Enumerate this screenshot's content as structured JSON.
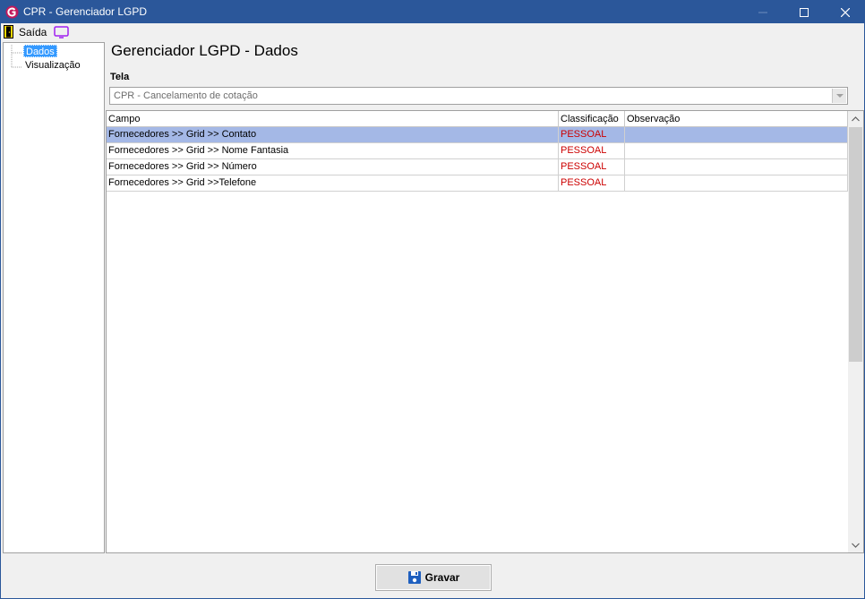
{
  "window": {
    "title": "CPR - Gerenciador LGPD"
  },
  "menu": {
    "exit_label": "Saída",
    "exit_icon": "door-exit-icon",
    "screen_icon": "monitor-icon"
  },
  "tree": {
    "items": [
      {
        "label": "Dados",
        "selected": true
      },
      {
        "label": "Visualização",
        "selected": false
      }
    ]
  },
  "main": {
    "title": "Gerenciador LGPD - Dados",
    "tela_label": "Tela",
    "tela_value": "CPR - Cancelamento de cotação"
  },
  "grid": {
    "columns": [
      "Campo",
      "Classificação",
      "Observação"
    ],
    "rows": [
      {
        "campo": "Fornecedores >> Grid >> Contato",
        "classificacao": "PESSOAL",
        "observacao": "",
        "selected": true
      },
      {
        "campo": "Fornecedores >> Grid >> Nome Fantasia",
        "classificacao": "PESSOAL",
        "observacao": "",
        "selected": false
      },
      {
        "campo": "Fornecedores >> Grid >> Número",
        "classificacao": "PESSOAL",
        "observacao": "",
        "selected": false
      },
      {
        "campo": "Fornecedores >> Grid >>Telefone",
        "classificacao": "PESSOAL",
        "observacao": "",
        "selected": false
      }
    ]
  },
  "footer": {
    "save_label": "Gravar",
    "save_icon": "floppy-disk-icon"
  },
  "colors": {
    "titlebar": "#2b579a",
    "selection": "#a4b8e6",
    "classification_text": "#cc0000",
    "tree_selection": "#3399ff"
  }
}
